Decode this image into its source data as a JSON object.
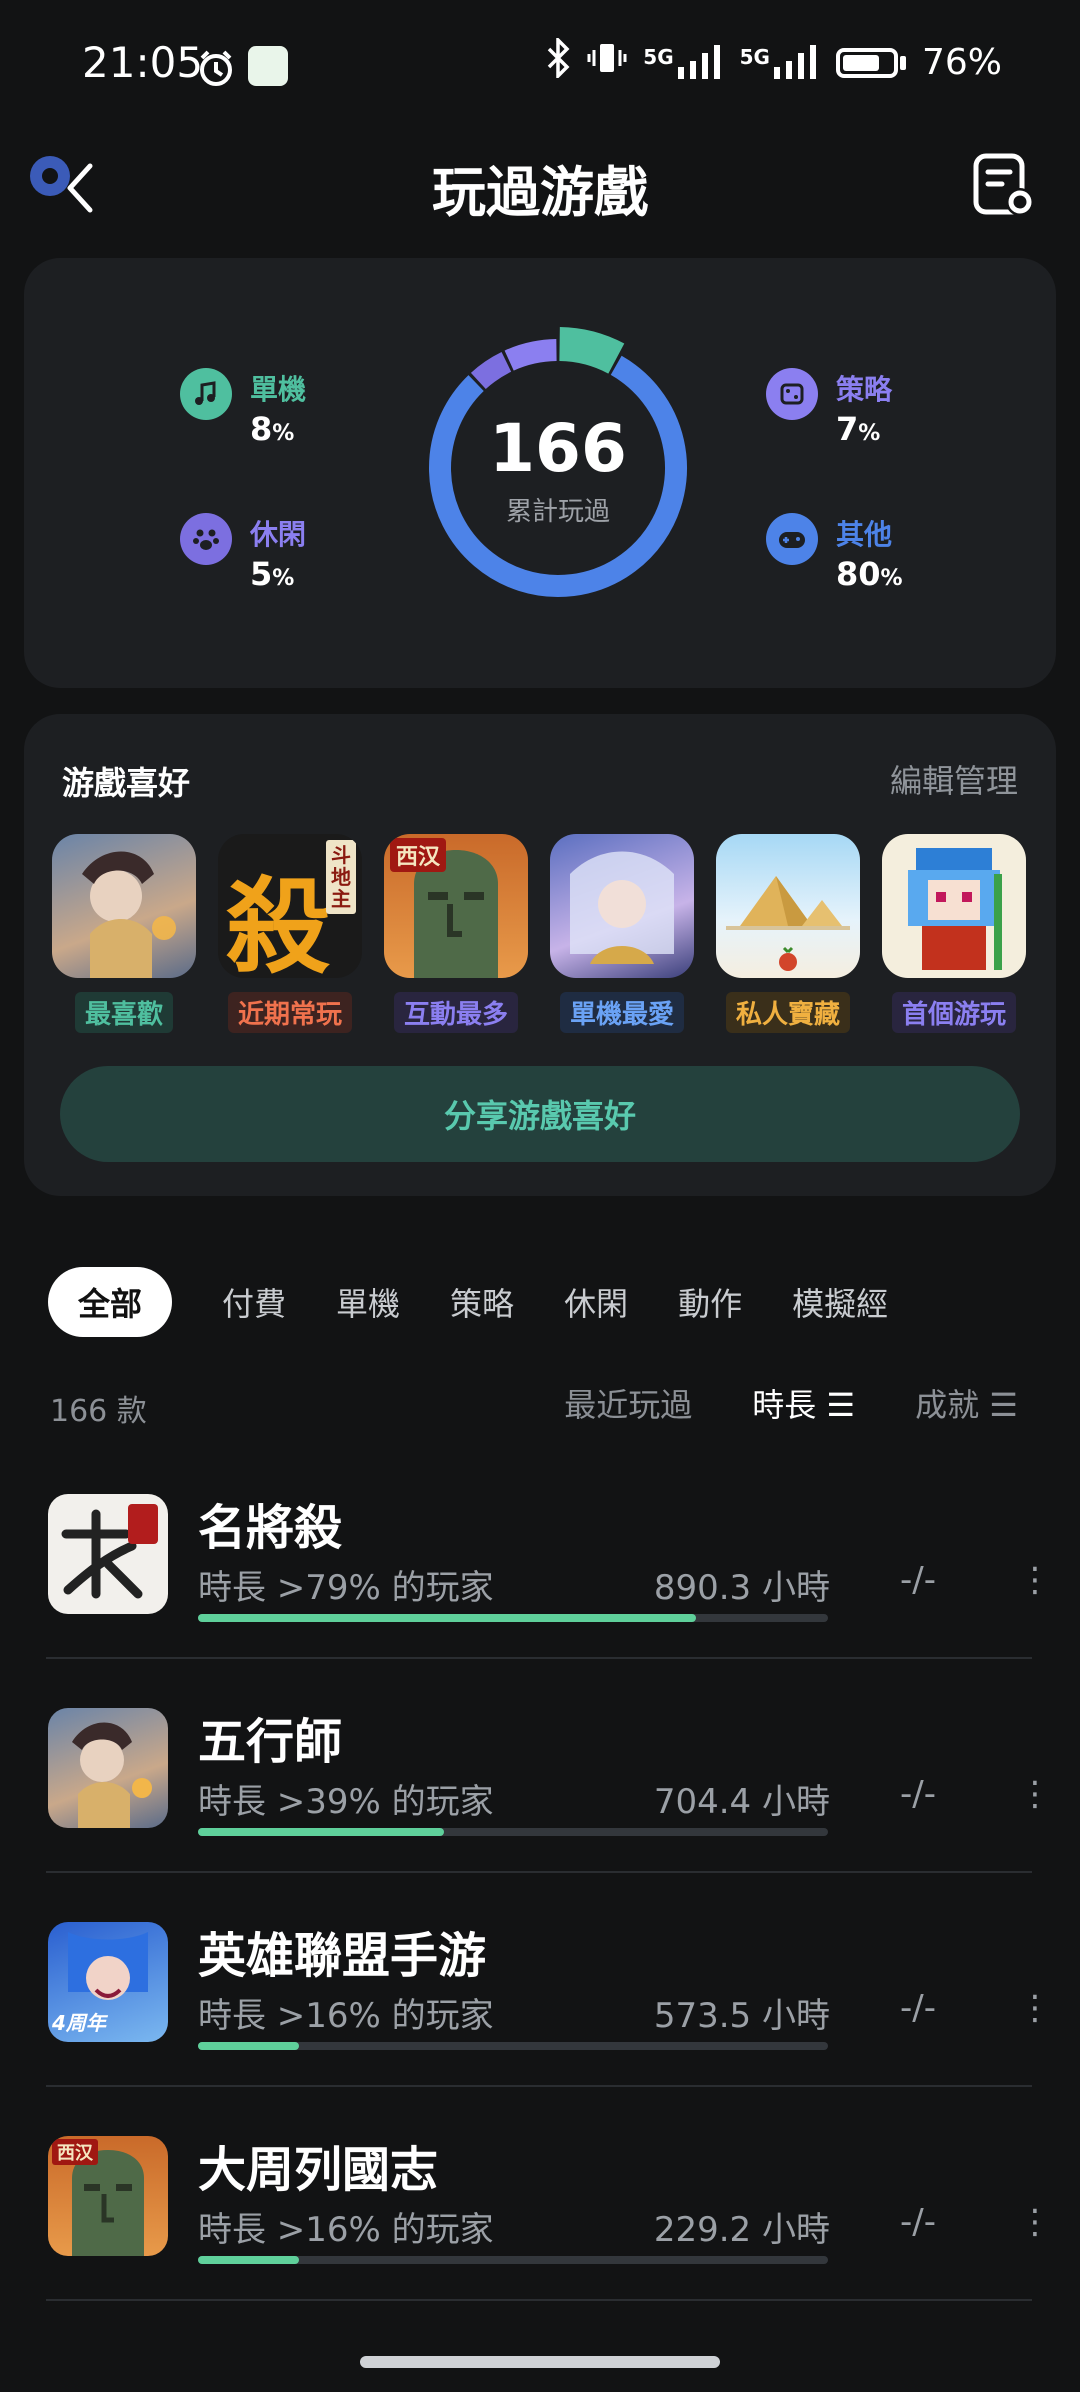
{
  "status_bar": {
    "time": "21:05",
    "network_5g": "5G",
    "battery": "76%",
    "battery_level": 0.76
  },
  "header": {
    "title": "玩過游戲"
  },
  "summary": {
    "total": "166",
    "total_label": "累計玩過",
    "categories": [
      {
        "label": "單機",
        "value": "8",
        "unit": "%",
        "color": "#4fbf9f",
        "icon": "music-note-icon"
      },
      {
        "label": "休閑",
        "value": "5",
        "unit": "%",
        "color": "#7c6fe0",
        "icon": "paw-icon"
      },
      {
        "label": "策略",
        "value": "7",
        "unit": "%",
        "color": "#8b7ff0",
        "icon": "dice-icon"
      },
      {
        "label": "其他",
        "value": "80",
        "unit": "%",
        "color": "#4d83e8",
        "icon": "gamepad-icon"
      }
    ]
  },
  "favorites": {
    "title": "游戲喜好",
    "edit_label": "編輯管理",
    "items": [
      {
        "tag": "最喜歡",
        "tag_color": "#4fbf9f",
        "tag_bg": "#1f3a35",
        "icon": "warrior-heroine-icon"
      },
      {
        "tag": "近期常玩",
        "tag_color": "#f0724d",
        "tag_bg": "#3d2320",
        "icon": "kill-calligraphy-icon",
        "art_text": "殺",
        "art_badge": "斗地主"
      },
      {
        "tag": "互動最多",
        "tag_color": "#8b7ff0",
        "tag_bg": "#29253f",
        "icon": "bronze-mask-icon",
        "art_badge": "西汉"
      },
      {
        "tag": "單機最愛",
        "tag_color": "#6aa2f5",
        "tag_bg": "#1f2c42",
        "icon": "angel-girl-icon"
      },
      {
        "tag": "私人寶藏",
        "tag_color": "#f0b040",
        "tag_bg": "#3a2f1a",
        "icon": "pyramid-icon"
      },
      {
        "tag": "首個游玩",
        "tag_color": "#8b7ff0",
        "tag_bg": "#29253f",
        "icon": "pixel-girl-icon"
      }
    ],
    "share_label": "分享游戲喜好"
  },
  "tabs": [
    "全部",
    "付費",
    "單機",
    "策略",
    "休閑",
    "動作",
    "模擬經"
  ],
  "list_meta": {
    "count": "166 款",
    "sort_options": [
      "最近玩過",
      "時長 ☰",
      "成就 ☰"
    ]
  },
  "games": [
    {
      "name": "名將殺",
      "sub": "時長 >79% 的玩家",
      "hours": "890.3 小時",
      "progress": 0.79,
      "achievement": "-/-",
      "more": "⋮",
      "icon": "calligraphy-sha-icon"
    },
    {
      "name": "五行師",
      "sub": "時長 >39% 的玩家",
      "hours": "704.4 小時",
      "progress": 0.39,
      "achievement": "-/-",
      "more": "⋮",
      "icon": "warrior-heroine-icon"
    },
    {
      "name": "英雄聯盟手游",
      "sub": "時長 >16% 的玩家",
      "hours": "573.5 小時",
      "progress": 0.16,
      "achievement": "-/-",
      "more": "⋮",
      "icon": "jinx-icon",
      "art_badge": "4周年"
    },
    {
      "name": "大周列國志",
      "sub": "時長 >16% 的玩家",
      "hours": "229.2 小時",
      "progress": 0.16,
      "achievement": "-/-",
      "more": "⋮",
      "icon": "bronze-mask-icon",
      "art_badge": "西汉"
    }
  ]
}
